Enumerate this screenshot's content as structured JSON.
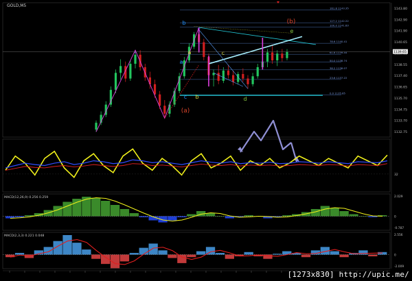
{
  "window": {
    "symbol_title": "GOLD,M5",
    "footer_watermark": "[1273x830] http://upic.me/"
  },
  "colors": {
    "background": "#000000",
    "bull_candle": "#22c55e",
    "bear_candle": "#d11f1f",
    "accent_cyan": "#22c7d6",
    "magenta": "#e040e0",
    "yellow": "#f2f21a",
    "blue": "#2f4cff",
    "red": "#e01f1f",
    "grid": "#2a2a2a",
    "fib": "#4a6fb0",
    "wave_label_blue": "#1e90ff",
    "wave_label_yellow": "#d8d83a",
    "wave_label_green": "#86c441",
    "wave_label_red": "#d9442b",
    "arrow": "#8f8fd4"
  },
  "chart_data": [
    {
      "id": "price",
      "type": "candlestick",
      "title": "GOLD,M5",
      "ylim": [
        1132.5,
        1143.5
      ],
      "y_ticks": [
        "1143.80",
        "1142.90",
        "1141.90",
        "1140.65",
        "1139.05",
        "1138.55",
        "1137.40",
        "1136.65",
        "1135.70",
        "1134.75",
        "1133.70",
        "1132.75"
      ],
      "price_labels": {
        "current": "1139.65"
      },
      "candles": [
        {
          "o": 1132.8,
          "h": 1133.6,
          "l": 1132.6,
          "c": 1133.4
        },
        {
          "o": 1133.4,
          "h": 1134.4,
          "l": 1133.2,
          "c": 1134.1
        },
        {
          "o": 1134.1,
          "h": 1135.3,
          "l": 1133.9,
          "c": 1135.0
        },
        {
          "o": 1135.0,
          "h": 1136.6,
          "l": 1134.8,
          "c": 1136.3
        },
        {
          "o": 1136.3,
          "h": 1138.1,
          "l": 1136.0,
          "c": 1137.8
        },
        {
          "o": 1137.8,
          "h": 1139.0,
          "l": 1137.2,
          "c": 1138.4
        },
        {
          "o": 1138.4,
          "h": 1138.8,
          "l": 1137.0,
          "c": 1137.3
        },
        {
          "o": 1137.3,
          "h": 1138.9,
          "l": 1137.1,
          "c": 1138.6
        },
        {
          "o": 1138.6,
          "h": 1139.6,
          "l": 1138.2,
          "c": 1139.4
        },
        {
          "o": 1139.4,
          "h": 1139.8,
          "l": 1138.0,
          "c": 1138.3
        },
        {
          "o": 1138.3,
          "h": 1138.6,
          "l": 1137.1,
          "c": 1137.4
        },
        {
          "o": 1137.4,
          "h": 1137.9,
          "l": 1136.4,
          "c": 1136.8
        },
        {
          "o": 1136.8,
          "h": 1137.2,
          "l": 1135.6,
          "c": 1135.9
        },
        {
          "o": 1135.9,
          "h": 1136.2,
          "l": 1134.6,
          "c": 1134.9
        },
        {
          "o": 1134.9,
          "h": 1135.4,
          "l": 1133.8,
          "c": 1134.2
        },
        {
          "o": 1134.2,
          "h": 1135.3,
          "l": 1133.9,
          "c": 1135.0
        },
        {
          "o": 1135.0,
          "h": 1136.5,
          "l": 1134.8,
          "c": 1136.2
        },
        {
          "o": 1136.2,
          "h": 1137.8,
          "l": 1136.0,
          "c": 1137.5
        },
        {
          "o": 1137.5,
          "h": 1139.2,
          "l": 1137.3,
          "c": 1138.9
        },
        {
          "o": 1138.9,
          "h": 1140.4,
          "l": 1138.7,
          "c": 1140.1
        },
        {
          "o": 1140.1,
          "h": 1141.4,
          "l": 1139.9,
          "c": 1141.2
        },
        {
          "o": 1141.2,
          "h": 1141.8,
          "l": 1140.2,
          "c": 1140.5
        },
        {
          "o": 1140.5,
          "h": 1140.8,
          "l": 1138.9,
          "c": 1139.2
        },
        {
          "o": 1139.2,
          "h": 1139.5,
          "l": 1137.3,
          "c": 1137.6
        },
        {
          "o": 1137.6,
          "h": 1138.1,
          "l": 1136.6,
          "c": 1137.8
        },
        {
          "o": 1137.8,
          "h": 1138.5,
          "l": 1136.8,
          "c": 1137.1
        },
        {
          "o": 1137.1,
          "h": 1138.3,
          "l": 1136.9,
          "c": 1138.0
        },
        {
          "o": 1138.0,
          "h": 1138.5,
          "l": 1137.3,
          "c": 1137.6
        },
        {
          "o": 1137.6,
          "h": 1138.0,
          "l": 1136.7,
          "c": 1137.0
        },
        {
          "o": 1137.0,
          "h": 1137.9,
          "l": 1136.8,
          "c": 1137.7
        },
        {
          "o": 1137.7,
          "h": 1138.2,
          "l": 1137.0,
          "c": 1137.3
        },
        {
          "o": 1137.3,
          "h": 1137.6,
          "l": 1136.4,
          "c": 1136.8
        },
        {
          "o": 1136.8,
          "h": 1137.8,
          "l": 1136.6,
          "c": 1137.5
        },
        {
          "o": 1137.5,
          "h": 1138.6,
          "l": 1137.3,
          "c": 1138.3
        },
        {
          "o": 1138.3,
          "h": 1140.6,
          "l": 1138.1,
          "c": 1138.8
        },
        {
          "o": 1138.8,
          "h": 1139.9,
          "l": 1138.3,
          "c": 1139.6
        },
        {
          "o": 1139.6,
          "h": 1140.3,
          "l": 1138.6,
          "c": 1138.9
        },
        {
          "o": 1138.9,
          "h": 1139.8,
          "l": 1138.4,
          "c": 1139.5
        },
        {
          "o": 1139.5,
          "h": 1139.9,
          "l": 1138.8,
          "c": 1139.1
        },
        {
          "o": 1139.1,
          "h": 1139.9,
          "l": 1138.9,
          "c": 1139.65
        }
      ],
      "fib_levels": [
        {
          "label": "100.0",
          "value": "1141.83"
        },
        {
          "label": "78.6",
          "value": "1140.41"
        },
        {
          "label": "61.8",
          "value": "1139.44"
        },
        {
          "label": "50.0",
          "value": "1138.74"
        },
        {
          "label": "38.2",
          "value": "1138.07"
        },
        {
          "label": "23.6",
          "value": "1137.22"
        },
        {
          "label": "0.0",
          "value": "1135.85"
        },
        {
          "label": "127.2",
          "value": "1142.22"
        },
        {
          "label": "161.8",
          "value": "1143.35"
        }
      ],
      "wave_labels": [
        "b",
        "a",
        "c",
        "b",
        "c",
        "d",
        "e",
        "(a)",
        "(b)",
        "a"
      ]
    },
    {
      "id": "oscillator",
      "type": "line",
      "ylim": [
        0,
        100
      ],
      "y_ticks": [
        "32"
      ],
      "series": [
        {
          "values": [
            40,
            70,
            55,
            30,
            65,
            80,
            45,
            25,
            60,
            75,
            50,
            35,
            70,
            85,
            55,
            40,
            65,
            50,
            30,
            60,
            75,
            45,
            55,
            70,
            40,
            60,
            50,
            65,
            45,
            55,
            70,
            60,
            50,
            65,
            55,
            45,
            70,
            60,
            50,
            72
          ]
        },
        {
          "values": [
            45,
            50,
            55,
            52,
            50,
            55,
            58,
            52,
            55,
            60,
            58,
            54,
            56,
            62,
            60,
            56,
            58,
            55,
            52,
            56,
            60,
            57,
            55,
            58,
            54,
            56,
            55,
            57,
            54,
            55,
            58,
            57,
            55,
            58,
            56,
            54,
            58,
            57,
            56,
            60
          ]
        },
        {
          "values": [
            40,
            44,
            48,
            46,
            45,
            48,
            50,
            47,
            49,
            52,
            50,
            48,
            50,
            54,
            53,
            50,
            51,
            49,
            47,
            50,
            53,
            51,
            50,
            52,
            49,
            51,
            50,
            51,
            49,
            50,
            52,
            51,
            50,
            52,
            51,
            49,
            52,
            51,
            50,
            54
          ]
        }
      ]
    },
    {
      "id": "macd1",
      "type": "bar",
      "title": "MACD(12,26,9) 0.256 0.259",
      "y_ticks": [
        "2.029",
        "0",
        "-0.787"
      ],
      "values": [
        -0.2,
        -0.1,
        0.1,
        0.3,
        0.6,
        1.0,
        1.4,
        1.7,
        1.9,
        1.8,
        1.5,
        1.1,
        0.7,
        0.3,
        -0.1,
        -0.4,
        -0.6,
        -0.4,
        -0.1,
        0.2,
        0.5,
        0.3,
        0.0,
        -0.2,
        -0.1,
        0.1,
        0.0,
        -0.2,
        -0.1,
        0.1,
        0.2,
        0.4,
        0.7,
        1.0,
        0.8,
        0.5,
        0.2,
        0.0,
        -0.1,
        0.1
      ]
    },
    {
      "id": "macd2",
      "type": "bar",
      "title": "MACD(2,3,3) 0.221 0.048",
      "y_ticks": [
        "2.556",
        "0",
        "-2.009"
      ],
      "values": [
        -0.3,
        0.2,
        -0.4,
        0.5,
        0.9,
        1.6,
        2.3,
        1.4,
        0.6,
        -0.5,
        -1.1,
        -1.6,
        -0.8,
        0.2,
        0.8,
        1.3,
        0.5,
        -0.4,
        -1.0,
        -0.3,
        0.4,
        0.9,
        0.2,
        -0.5,
        -0.2,
        0.3,
        -0.2,
        -0.5,
        0.1,
        0.4,
        0.2,
        -0.3,
        0.5,
        0.9,
        0.4,
        -0.3,
        0.2,
        0.5,
        -0.2,
        0.3
      ]
    }
  ]
}
